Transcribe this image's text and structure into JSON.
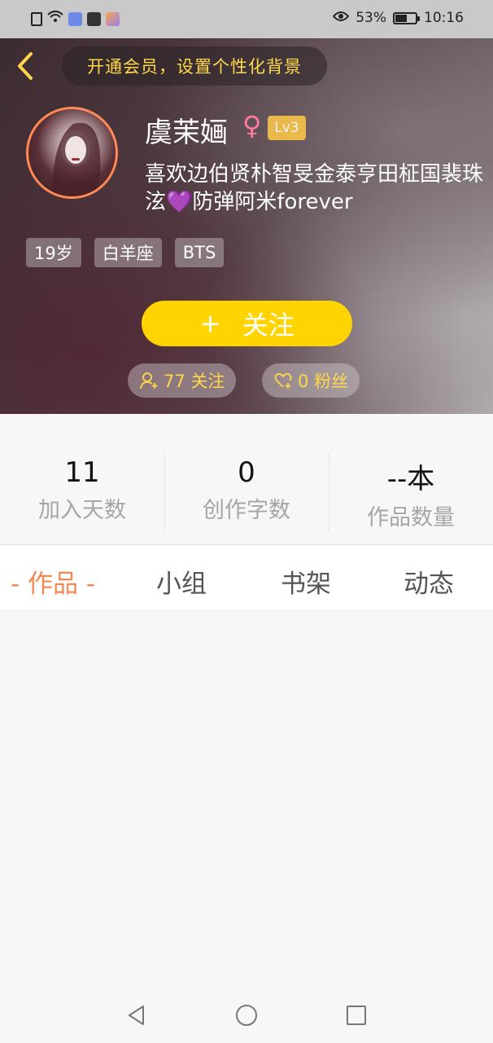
{
  "status_bar": {
    "battery": "53%",
    "time": "10:16",
    "battery_level": 0.53
  },
  "header": {
    "vip_banner": "开通会员，设置个性化背景",
    "name": "虞茉婳",
    "gender_symbol": "♀",
    "level": "Lv3",
    "bio": "喜欢边伯贤朴智旻金泰亨田柾国裴珠泫💜防弹阿米forever",
    "tags": [
      "19岁",
      "白羊座",
      "BTS"
    ],
    "follow_label": "关注",
    "follow_plus": "+",
    "following": "77 关注",
    "fans": "0 粉丝"
  },
  "stats": [
    {
      "value": "11",
      "label": "加入天数"
    },
    {
      "value": "0",
      "label": "创作字数"
    },
    {
      "value": "--本",
      "label": "作品数量"
    }
  ],
  "tabs": [
    "- 作品 -",
    "小组",
    "书架",
    "动态"
  ],
  "colors": {
    "accent_yellow": "#ffd400",
    "active_tab": "#f28a54",
    "vip_text": "#ffd84a"
  }
}
